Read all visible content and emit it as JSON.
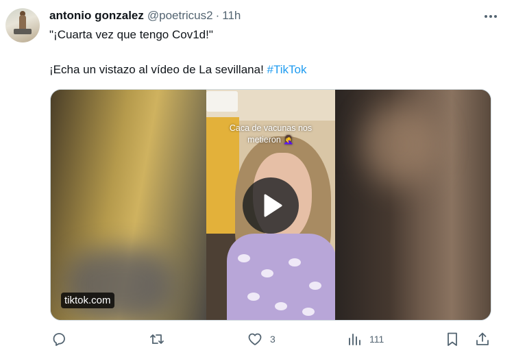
{
  "tweet": {
    "author_name": "antonio gonzalez",
    "handle": "@poetricus2",
    "separator": "·",
    "time": "11h",
    "text_line1": "\"¡Cuarta vez que tengo Cov1d!\"",
    "text_line2": "¡Echa un vistazo al vídeo de La sevillana!",
    "hashtag": "#TikTok"
  },
  "media": {
    "caption_line1": "Caca de vacunas nos",
    "caption_line2": "metieron 🤦‍♀️",
    "domain": "tiktok.com"
  },
  "actions": {
    "replies": "",
    "retweets": "",
    "likes": "3",
    "views": "111"
  },
  "icons": [
    "more-icon",
    "reply-icon",
    "retweet-icon",
    "like-icon",
    "views-icon",
    "bookmark-icon",
    "share-icon",
    "play-icon"
  ],
  "colors": {
    "link": "#1d9bf0",
    "text": "#0f1419",
    "muted": "#536471"
  }
}
